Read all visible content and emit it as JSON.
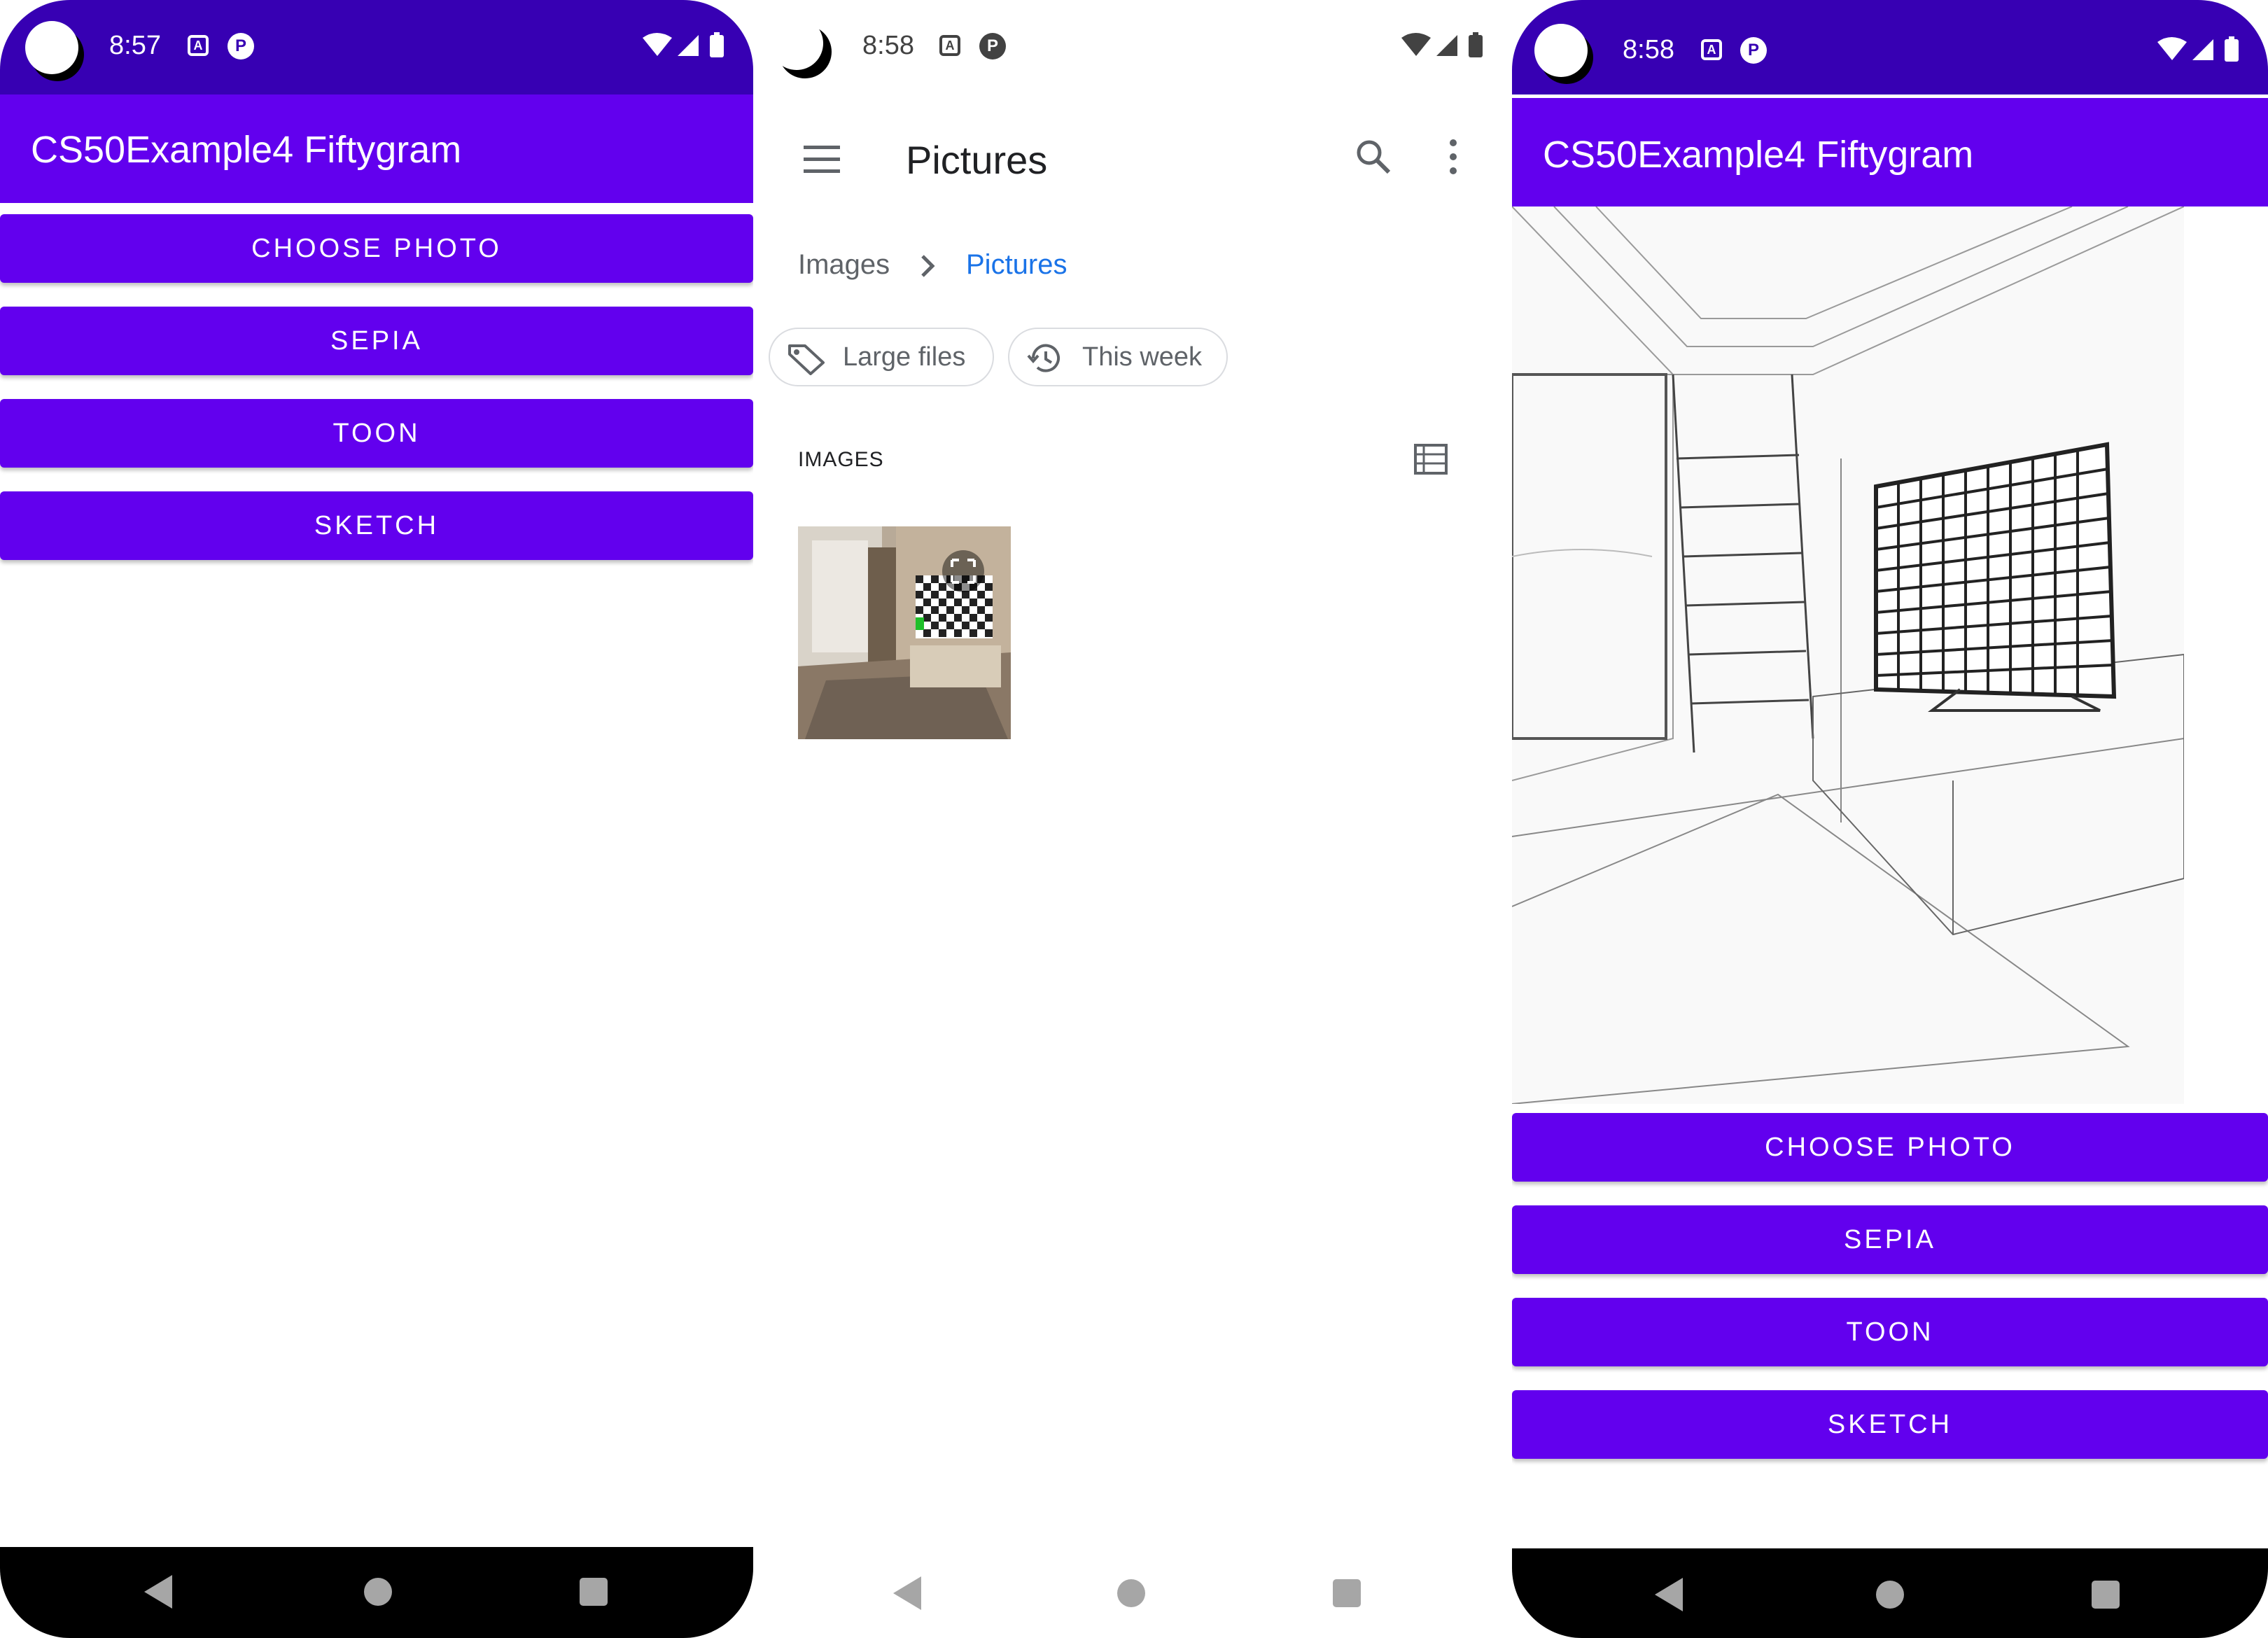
{
  "left_screen": {
    "status": {
      "time": "8:57",
      "icon1": "A"
    },
    "app_title": "CS50Example4 Fiftygram",
    "buttons": [
      "CHOOSE PHOTO",
      "SEPIA",
      "TOON",
      "SKETCH"
    ]
  },
  "middle_screen": {
    "status": {
      "time": "8:58",
      "icon1": "A"
    },
    "title": "Pictures",
    "breadcrumb": [
      "Images",
      "Pictures"
    ],
    "chips": [
      "Large files",
      "This week"
    ],
    "section_label": "IMAGES",
    "icons": [
      "menu-icon",
      "search-icon",
      "more-vert-icon",
      "tag-icon",
      "history-icon",
      "list-view-icon",
      "expand-icon"
    ]
  },
  "right_screen": {
    "status": {
      "time": "8:58",
      "icon1": "A"
    },
    "app_title": "CS50Example4 Fiftygram",
    "buttons": [
      "CHOOSE PHOTO",
      "SEPIA",
      "TOON",
      "SKETCH"
    ]
  },
  "colors": {
    "primary": "#6200ee",
    "primary_dark": "#3700b3",
    "link_blue": "#1a73e8",
    "nav_black": "#000000"
  }
}
